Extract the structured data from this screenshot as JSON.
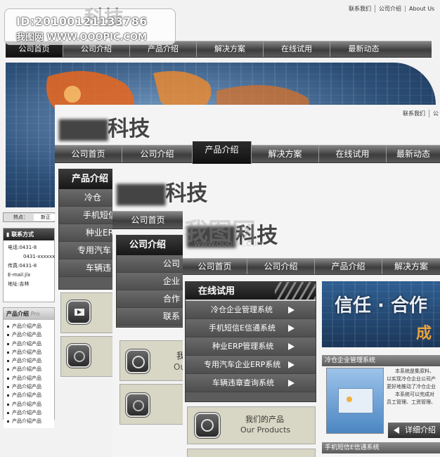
{
  "watermark": {
    "id_line": "ID:20100121133786",
    "site_line": "我图网 WWW.OOOPIC.COM"
  },
  "top_links": [
    "联系我们",
    "公司介绍",
    "About Us"
  ],
  "layer1": {
    "logo_suffix": "科技",
    "nav": [
      "公司首页",
      "公司介绍",
      "产品介绍",
      "解决方案",
      "在线试用",
      "最新动态"
    ],
    "hot_label": "热点：",
    "hot_text": "新正",
    "contact_title": "联系方式",
    "contact_lines": [
      "电话:0431-8",
      "0431-xxxxxxxx",
      "传真:0431-8",
      "E-mail:jlx",
      "地址:吉林"
    ],
    "products_title": "产品介绍",
    "products_sub": "Pro",
    "product_rows": [
      "产品介绍产品",
      "产品介绍产品",
      "产品介绍产品",
      "产品介绍产品",
      "产品介绍产品",
      "产品介绍产品",
      "产品介绍产品",
      "产品介绍产品",
      "产品介绍产品",
      "产品介绍产品",
      "产品介绍产品",
      "产品介绍产品"
    ]
  },
  "layer2": {
    "top_links": [
      "联系我们",
      "公"
    ],
    "logo_suffix": "科技",
    "nav": [
      "公司首页",
      "公司介绍",
      "产品介绍",
      "解决方案",
      "在线试用",
      "最新动态"
    ],
    "panel_title": "产品介绍",
    "items": [
      "冷仓",
      "手机短信",
      "种业ER",
      "专用汽车",
      "车辆违"
    ]
  },
  "layer3": {
    "logo_suffix": "科技",
    "nav": [
      "公司首页",
      "公司"
    ],
    "panel_title": "公司介绍",
    "items": [
      "公司",
      "企业",
      "合作",
      "联系"
    ],
    "card_texts": [
      "我",
      "Ou"
    ]
  },
  "layer4": {
    "logo_suffix": "科技",
    "nav": [
      "公司首页",
      "公司介绍",
      "产品介绍",
      "解决方案"
    ],
    "panel_title": "在线试用",
    "items": [
      "冷仓企业管理系统",
      "手机短信E信通系统",
      "种业ERP管理系统",
      "专用汽车企业ERP系统",
      "车辆违章查询系统"
    ],
    "card_cn": "我们的产品",
    "card_en": "Our Products",
    "banner_text": "信任 · 合作",
    "banner_sub": "成",
    "sys1_title": "冷仓企业管理系统",
    "sys1_desc": [
      "本系统是集原料、",
      "以实现冷仓企业公司产",
      "更好地推动了冷仓企业",
      "本系统可以完成对",
      "员工管理、工资管理、"
    ],
    "detail_label": "详细介绍",
    "sys2_title": "手机短信E信通系统"
  },
  "faint_center": {
    "brand": "我图网",
    "url": "WWW.OOOPIC.COM"
  }
}
